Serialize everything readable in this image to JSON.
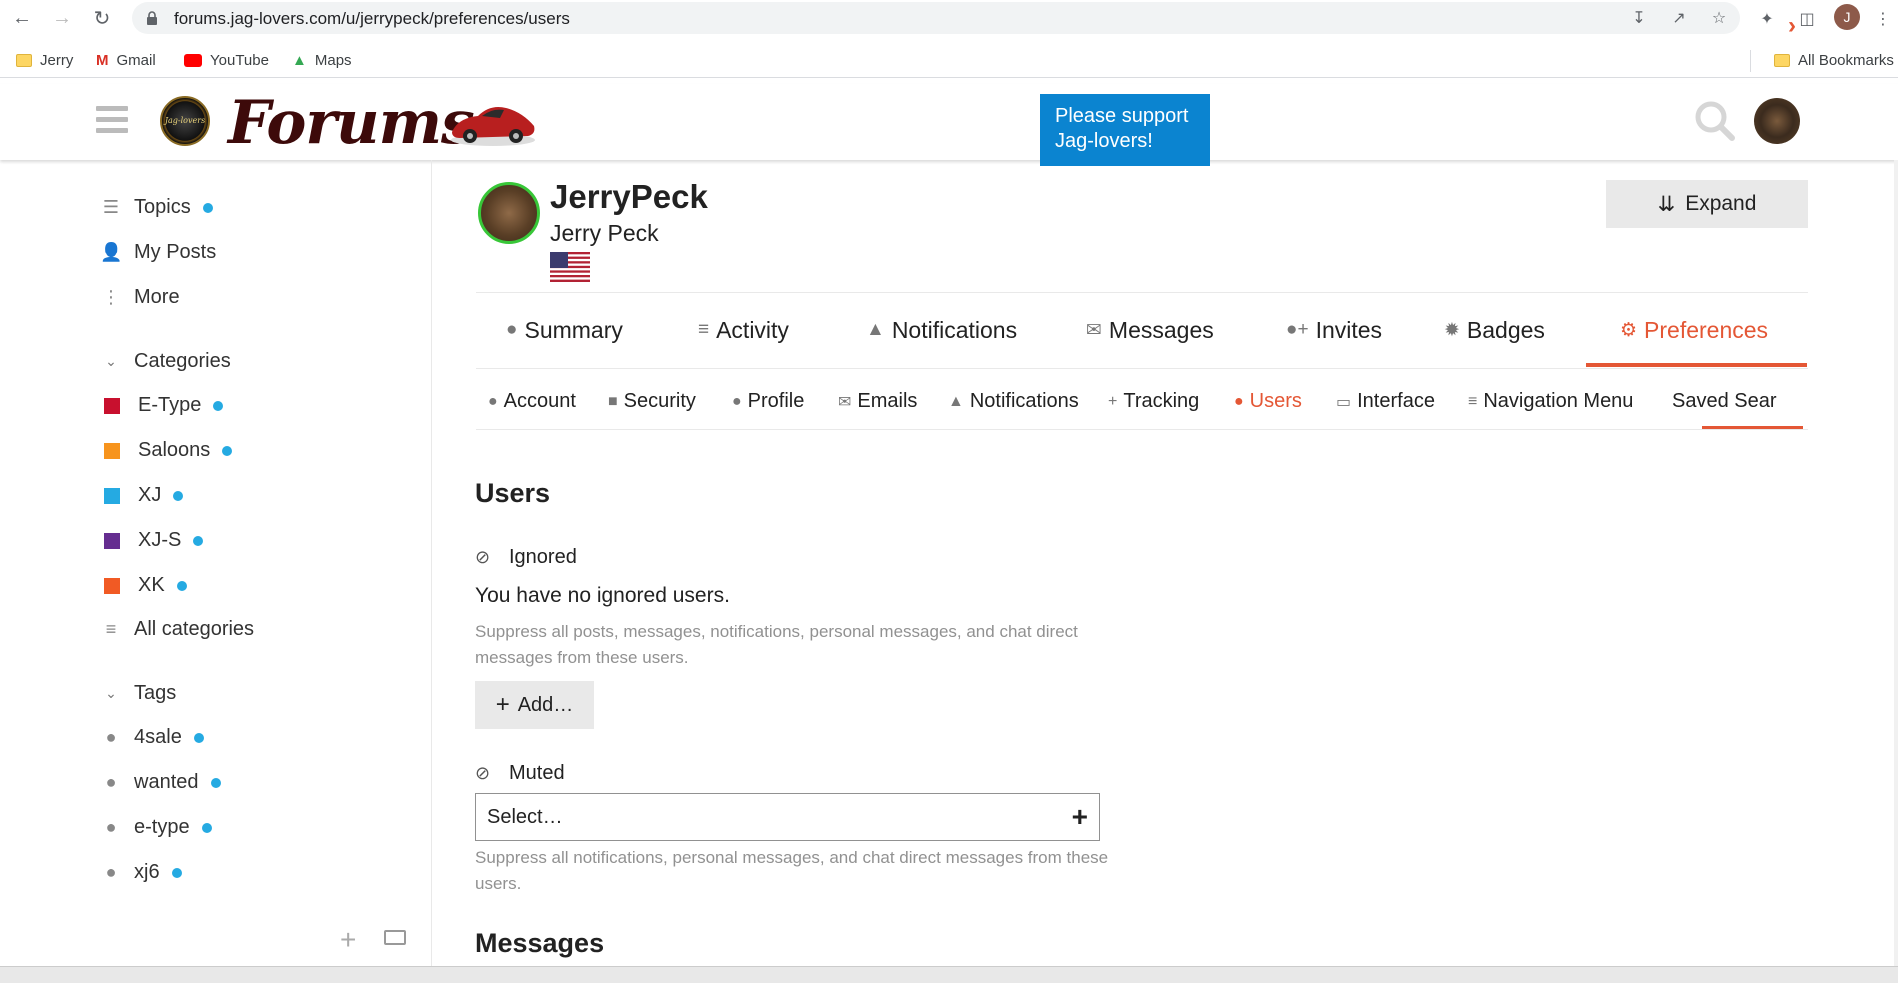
{
  "browser": {
    "url": "forums.jag-lovers.com/u/jerrypeck/preferences/users",
    "profile_initial": "J",
    "bookmarks": [
      "Jerry",
      "Gmail",
      "YouTube",
      "Maps"
    ],
    "all_bookmarks": "All Bookmarks"
  },
  "header": {
    "logo_text": "Forums",
    "badge_text": "Jag-lovers",
    "support_banner": "Please support Jag-lovers!"
  },
  "sidebar": {
    "top_items": [
      {
        "label": "Topics",
        "icon": "layers-icon",
        "unread": true
      },
      {
        "label": "My Posts",
        "icon": "user-icon",
        "unread": false
      },
      {
        "label": "More",
        "icon": "more-vertical-icon",
        "unread": false
      }
    ],
    "categories_heading": "Categories",
    "categories": [
      {
        "label": "E-Type",
        "color": "#c8102e"
      },
      {
        "label": "Saloons",
        "color": "#f7941d"
      },
      {
        "label": "XJ",
        "color": "#25aae2"
      },
      {
        "label": "XJ-S",
        "color": "#652d90"
      },
      {
        "label": "XK",
        "color": "#f15a24"
      }
    ],
    "all_categories": "All categories",
    "tags_heading": "Tags",
    "tags": [
      "4sale",
      "wanted",
      "e-type",
      "xj6"
    ]
  },
  "profile": {
    "username": "JerryPeck",
    "full_name": "Jerry Peck",
    "expand_label": "Expand"
  },
  "main_nav": [
    {
      "label": "Summary",
      "icon": "user-icon"
    },
    {
      "label": "Activity",
      "icon": "stream-icon"
    },
    {
      "label": "Notifications",
      "icon": "bell-icon"
    },
    {
      "label": "Messages",
      "icon": "envelope-icon"
    },
    {
      "label": "Invites",
      "icon": "user-plus-icon"
    },
    {
      "label": "Badges",
      "icon": "badge-icon"
    },
    {
      "label": "Preferences",
      "icon": "gear-icon",
      "active": true
    }
  ],
  "sub_nav": [
    {
      "label": "Account",
      "icon": "user-icon"
    },
    {
      "label": "Security",
      "icon": "lock-icon"
    },
    {
      "label": "Profile",
      "icon": "user-icon"
    },
    {
      "label": "Emails",
      "icon": "envelope-icon"
    },
    {
      "label": "Notifications",
      "icon": "bell-icon"
    },
    {
      "label": "Tracking",
      "icon": "plus-icon"
    },
    {
      "label": "Users",
      "icon": "users-icon",
      "active": true
    },
    {
      "label": "Interface",
      "icon": "desktop-icon"
    },
    {
      "label": "Navigation Menu",
      "icon": "bars-icon"
    },
    {
      "label": "Saved Sear",
      "icon": ""
    }
  ],
  "content": {
    "section_title": "Users",
    "ignored_label": "Ignored",
    "no_ignored": "You have no ignored users.",
    "ignored_help": "Suppress all posts, messages, notifications, personal messages, and chat direct messages from these users.",
    "add_label": "Add…",
    "muted_label": "Muted",
    "muted_placeholder": "Select…",
    "muted_help": "Suppress all notifications, personal messages, and chat direct messages from these users.",
    "messages_title": "Messages"
  },
  "colors": {
    "accent": "#e45735",
    "banner": "#0b84d0",
    "unread_dot": "#25aae2"
  }
}
